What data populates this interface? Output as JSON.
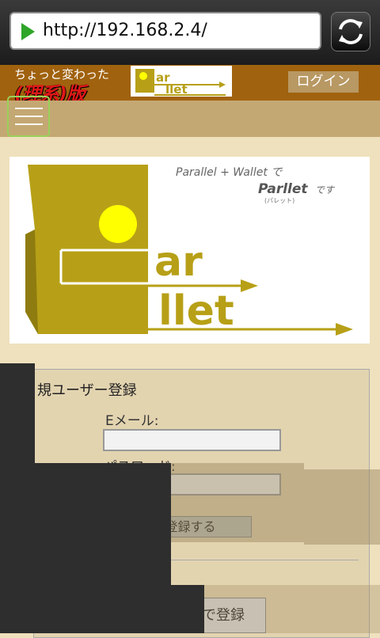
{
  "browser": {
    "url": "http://192.168.2.4/"
  },
  "header": {
    "tagline_line1": "ちょっと変わった",
    "tagline_line2": "(理系)版",
    "mini_logo": {
      "line1": "ar",
      "line2": "llet"
    },
    "login_label": "ログイン"
  },
  "banner": {
    "slogan": "Parallel + Wallet で",
    "brand": "Parllet",
    "desu": "です",
    "reading": "(パレット)",
    "logo_text_1": "ar",
    "logo_text_2": "llet"
  },
  "form": {
    "title": "規ユーザー登録",
    "email_label": "Eメール:",
    "email_value": "",
    "password_label": "パスワード:",
    "password_value": "",
    "register_button": "ザー登録する",
    "social_button": "で登録"
  },
  "colors": {
    "brand_olive": "#b7a017",
    "logo_yellow": "#ffff00",
    "header_brown": "#a0620e",
    "nav_tan": "#c4a873",
    "page_bg": "#efe1bd"
  }
}
